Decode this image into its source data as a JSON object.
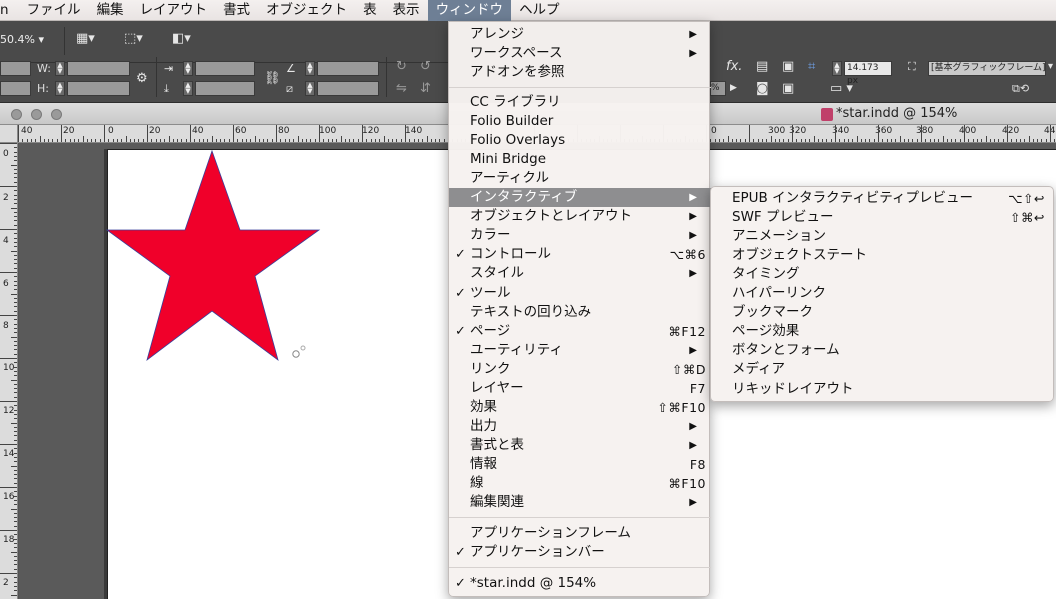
{
  "menubar": {
    "items": [
      "n",
      "ファイル",
      "編集",
      "レイアウト",
      "書式",
      "オブジェクト",
      "表",
      "表示",
      "ウィンドウ",
      "ヘルプ"
    ],
    "active": "ウィンドウ"
  },
  "control_panel": {
    "zoom": "50.4%",
    "w_label": "W:",
    "h_label": "H:",
    "stroke_weight": "14.173 px",
    "frame_style": "[基本グラフィックフレーム]",
    "percent_fragment": "%"
  },
  "document": {
    "title": "*star.indd @ 154%",
    "star_color": "#f0002a"
  },
  "rulers": {
    "h_left": [
      "40",
      "20",
      "0",
      "20",
      "40",
      "60",
      "80",
      "100",
      "120",
      "140"
    ],
    "h_right": [
      "300",
      "320",
      "340",
      "360",
      "380",
      "400",
      "420",
      "44"
    ],
    "h_cut": "0",
    "v": [
      "0",
      "2",
      "4",
      "6",
      "8",
      "10",
      "12",
      "14",
      "16",
      "18",
      "2"
    ]
  },
  "window_menu": {
    "items": [
      {
        "label": "アレンジ",
        "submenu": true
      },
      {
        "label": "ワークスペース",
        "submenu": true
      },
      {
        "label": "アドオンを参照"
      },
      {
        "label": "CC ライブラリ"
      },
      {
        "label": "Folio Builder"
      },
      {
        "label": "Folio Overlays"
      },
      {
        "label": "Mini Bridge"
      },
      {
        "label": "アーティクル"
      },
      {
        "label": "インタラクティブ",
        "submenu": true,
        "highlighted": true
      },
      {
        "label": "オブジェクトとレイアウト",
        "submenu": true
      },
      {
        "label": "カラー",
        "submenu": true
      },
      {
        "label": "コントロール",
        "checked": true,
        "shortcut": "⌥⌘6"
      },
      {
        "label": "スタイル",
        "submenu": true
      },
      {
        "label": "ツール",
        "checked": true
      },
      {
        "label": "テキストの回り込み"
      },
      {
        "label": "ページ",
        "checked": true,
        "shortcut": "⌘F12"
      },
      {
        "label": "ユーティリティ",
        "submenu": true
      },
      {
        "label": "リンク",
        "shortcut": "⇧⌘D"
      },
      {
        "label": "レイヤー",
        "shortcut": "F7"
      },
      {
        "label": "効果",
        "shortcut": "⇧⌘F10"
      },
      {
        "label": "出力",
        "submenu": true
      },
      {
        "label": "書式と表",
        "submenu": true
      },
      {
        "label": "情報",
        "shortcut": "F8"
      },
      {
        "label": "線",
        "shortcut": "⌘F10"
      },
      {
        "label": "編集関連",
        "submenu": true
      },
      {
        "label": "アプリケーションフレーム"
      },
      {
        "label": "アプリケーションバー",
        "checked": true
      },
      {
        "label": "*star.indd @ 154%",
        "checked": true
      }
    ]
  },
  "interactive_submenu": {
    "items": [
      {
        "label": "EPUB インタラクティビティプレビュー",
        "shortcut": "⌥⇧↩"
      },
      {
        "label": "SWF プレビュー",
        "shortcut": "⇧⌘↩"
      },
      {
        "label": "アニメーション"
      },
      {
        "label": "オブジェクトステート"
      },
      {
        "label": "タイミング"
      },
      {
        "label": "ハイパーリンク"
      },
      {
        "label": "ブックマーク"
      },
      {
        "label": "ページ効果"
      },
      {
        "label": "ボタンとフォーム"
      },
      {
        "label": "メディア"
      },
      {
        "label": "リキッドレイアウト"
      }
    ]
  },
  "icons": {
    "arrow": "▶",
    "check": "✓"
  }
}
